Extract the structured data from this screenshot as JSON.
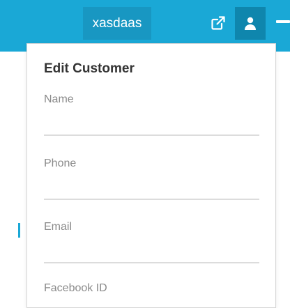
{
  "header": {
    "user_name": "xasdaas",
    "open_external_icon": "external-link-icon",
    "profile_icon": "user-icon",
    "menu_icon": "minus-icon",
    "colors": {
      "bar": "#1aa8d6",
      "user_button": "#1897c2",
      "profile_button": "#0f86ad"
    }
  },
  "form": {
    "title": "Edit Customer",
    "fields": [
      {
        "label": "Name",
        "value": ""
      },
      {
        "label": "Phone",
        "value": ""
      },
      {
        "label": "Email",
        "value": ""
      },
      {
        "label": "Facebook ID",
        "value": ""
      }
    ]
  }
}
